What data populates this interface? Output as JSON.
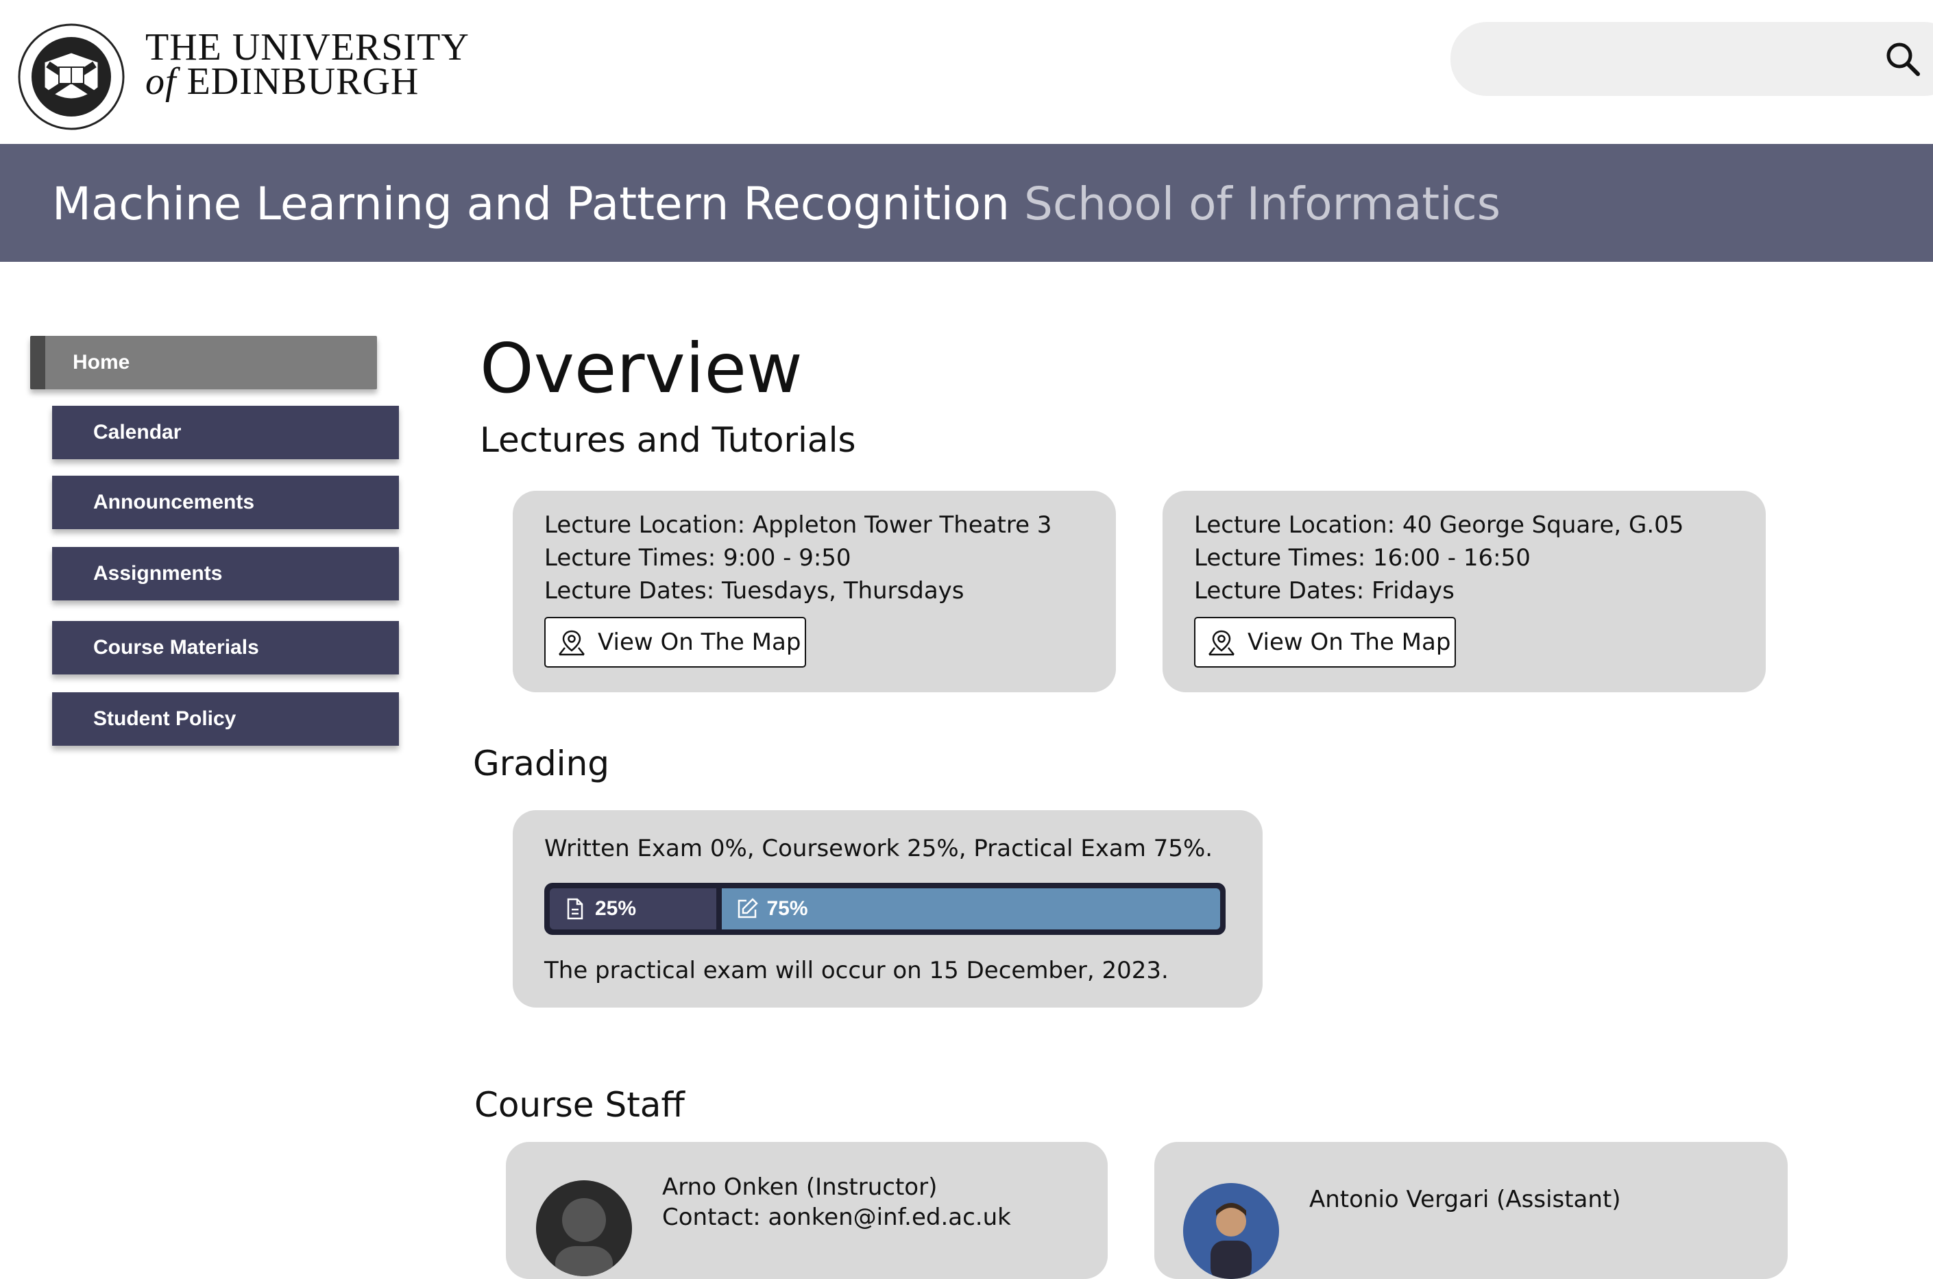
{
  "header": {
    "logo_text": "THE UNIVERSITY OF EDINBURGH",
    "uni_line1": "THE UNIVERSITY",
    "uni_of": "of",
    "uni_line2": "EDINBURGH",
    "search_placeholder": ""
  },
  "banner": {
    "course_title": "Machine Learning and Pattern Recognition",
    "school": "School of Informatics"
  },
  "sidebar": {
    "items": [
      {
        "label": "Home",
        "active": true
      },
      {
        "label": "Calendar"
      },
      {
        "label": "Announcements"
      },
      {
        "label": "Assignments"
      },
      {
        "label": "Course Materials"
      },
      {
        "label": "Student Policy"
      }
    ]
  },
  "main": {
    "page_title": "Overview",
    "lectures": {
      "heading": "Lectures and Tutorials",
      "cards": [
        {
          "location": "Lecture Location: Appleton Tower Theatre 3",
          "times": "Lecture Times: 9:00 - 9:50",
          "dates": "Lecture Dates: Tuesdays, Thursdays",
          "button": "View On The Map"
        },
        {
          "location": "Lecture Location: 40 George Square, G.05",
          "times": "Lecture Times: 16:00 - 16:50",
          "dates": "Lecture Dates: Fridays",
          "button": "View On The Map"
        }
      ]
    },
    "grading": {
      "heading": "Grading",
      "summary": "Written Exam 0%, Coursework 25%, Practical Exam 75%.",
      "coursework_pct": 25,
      "practical_pct": 75,
      "coursework_label": "25%",
      "practical_label": "75%",
      "note": "The practical exam will occur on 15 December, 2023."
    },
    "staff": {
      "heading": "Course Staff",
      "members": [
        {
          "name": "Arno Onken (Instructor)",
          "contact": "Contact: aonken@inf.ed.ac.uk"
        },
        {
          "name": "Antonio Vergari (Assistant)",
          "contact": ""
        }
      ]
    }
  },
  "colors": {
    "banner": "#5c5f78",
    "nav_item": "#3f405d",
    "nav_active": "#7d7d7d",
    "card": "#d9d9d9",
    "bar_coursework": "#3f405d",
    "bar_practical": "#6490b6"
  }
}
